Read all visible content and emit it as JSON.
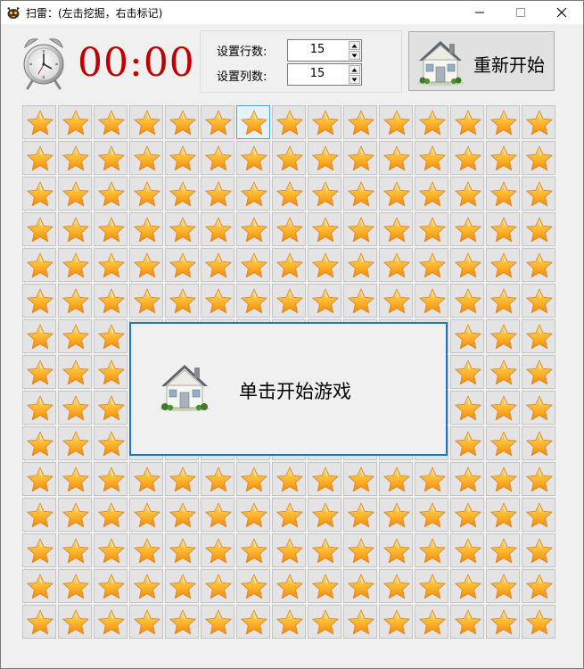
{
  "window": {
    "title": "扫雷：(左击挖掘，右击标记)",
    "controls": [
      "minimize",
      "maximize",
      "close"
    ]
  },
  "timer": {
    "icon": "alarm-clock-icon",
    "display": "00:00",
    "color": "#c00000"
  },
  "settings": {
    "rows_label": "设置行数:",
    "rows_value": "15",
    "cols_label": "设置列数:",
    "cols_value": "15"
  },
  "restart_button": {
    "label": "重新开始",
    "icon": "house-icon"
  },
  "board": {
    "rows": 15,
    "cols": 15,
    "tile_icon": "star-icon",
    "selected_cell": {
      "row": 1,
      "col": 7
    }
  },
  "start_dialog": {
    "text": "单击开始游戏",
    "icon": "house-icon",
    "border_color": "#1a78c2"
  }
}
